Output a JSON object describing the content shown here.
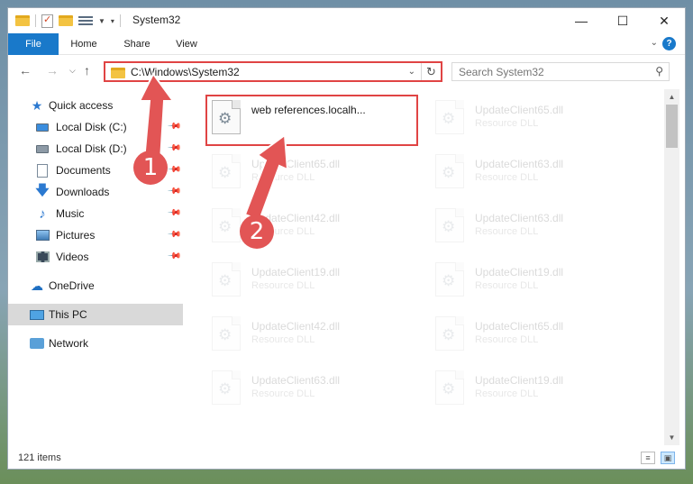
{
  "window": {
    "title": "System32"
  },
  "ribbon": {
    "tabs": [
      "File",
      "Home",
      "Share",
      "View"
    ],
    "help": "?"
  },
  "address": {
    "path": "C:\\Windows\\System32"
  },
  "search": {
    "placeholder": "Search System32"
  },
  "sidebar": {
    "items": [
      {
        "label": "Quick access"
      },
      {
        "label": "Local Disk (C:)"
      },
      {
        "label": "Local Disk (D:)"
      },
      {
        "label": "Documents"
      },
      {
        "label": "Downloads"
      },
      {
        "label": "Music"
      },
      {
        "label": "Pictures"
      },
      {
        "label": "Videos"
      },
      {
        "label": "OneDrive"
      },
      {
        "label": "This PC"
      },
      {
        "label": "Network"
      }
    ]
  },
  "files": {
    "highlighted": {
      "name": "web references.localh..."
    },
    "left_column": [
      {
        "name": "UpdateClient65.dll",
        "type": "Resource DLL"
      },
      {
        "name": "UpdateClient42.dll",
        "type": "Resource DLL"
      },
      {
        "name": "UpdateClient19.dll",
        "type": "Resource DLL"
      },
      {
        "name": "UpdateClient42.dll",
        "type": "Resource DLL"
      },
      {
        "name": "UpdateClient63.dll",
        "type": "Resource DLL"
      }
    ],
    "right_column": [
      {
        "name": "UpdateClient65.dll",
        "type": "Resource DLL"
      },
      {
        "name": "UpdateClient63.dll",
        "type": "Resource DLL"
      },
      {
        "name": "UpdateClient63.dll",
        "type": "Resource DLL"
      },
      {
        "name": "UpdateClient19.dll",
        "type": "Resource DLL"
      },
      {
        "name": "UpdateClient65.dll",
        "type": "Resource DLL"
      },
      {
        "name": "UpdateClient19.dll",
        "type": "Resource DLL"
      }
    ]
  },
  "status": {
    "item_count": "121 items"
  },
  "annotations": {
    "step1": "1",
    "step2": "2"
  },
  "colors": {
    "accent": "#1979ca",
    "highlight": "#e04444",
    "badge": "#e25555"
  }
}
